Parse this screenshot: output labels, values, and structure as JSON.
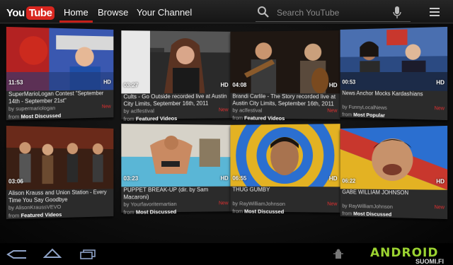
{
  "header": {
    "logo_you": "You",
    "logo_tube": "Tube",
    "tabs": [
      {
        "label": "Home",
        "active": true
      },
      {
        "label": "Browse"
      },
      {
        "label": "Your Channel"
      }
    ],
    "search_placeholder": "Search YouTube",
    "accent_color": "#c51f1a"
  },
  "videos": [
    {
      "duration": "11:53",
      "hd": "HD",
      "title": "SuperMarioLogan Contest \"September 14th - September 21st\"",
      "by": "by supermariologan",
      "from_prefix": "from",
      "from": "Most Discussed",
      "new": "New"
    },
    {
      "duration": "03:27",
      "hd": "HD",
      "title": "Cults - Go Outside recorded live at Austin City Limits, September 16th, 2011",
      "by": "by aclfestival",
      "from_prefix": "from",
      "from": "Featured Videos",
      "new": "New"
    },
    {
      "duration": "04:08",
      "hd": "HD",
      "title": "Brandi Carlile - The Story recorded live at Austin City Limits, September 16th, 2011",
      "by": "by aclfestival",
      "from_prefix": "from",
      "from": "Featured Videos",
      "new": "New"
    },
    {
      "duration": "00:53",
      "hd": "HD",
      "title": "News Anchor Mocks Kardashians",
      "by": "by FunnyLocalNews",
      "from_prefix": "from",
      "from": "Most Popular",
      "new": "New"
    },
    {
      "duration": "03:06",
      "hd": "HD",
      "title": "Alison Krauss and Union Station - Every Time You Say Goodbye",
      "by": "by AlisonKraussVEVO",
      "from_prefix": "from",
      "from": "Featured Videos",
      "new": ""
    },
    {
      "duration": "03:23",
      "hd": "HD",
      "title": "PUPPET BREAK-UP (dir. by Sam Macaroni)",
      "by": "by Yourfavoritemartian",
      "from_prefix": "from",
      "from": "Most Discussed",
      "new": "New"
    },
    {
      "duration": "06:55",
      "hd": "HD",
      "title": "THUG GUMBY",
      "by": "by RayWilliamJohnson",
      "from_prefix": "from",
      "from": "Most Discussed",
      "new": "New"
    },
    {
      "duration": "06:22",
      "hd": "HD",
      "title": "GABE WILLIAM JOHNSON",
      "by": "by RayWilliamJohnson",
      "from_prefix": "from",
      "from": "Most Discussed",
      "new": "New"
    }
  ],
  "icons": {
    "back": "back-icon",
    "home": "home-icon",
    "recent": "recent-apps-icon",
    "search": "search-icon",
    "mic": "microphone-icon",
    "menu": "menu-icon"
  },
  "watermark": {
    "name": "ANDROID",
    "sub": "SUOMI.FI"
  }
}
